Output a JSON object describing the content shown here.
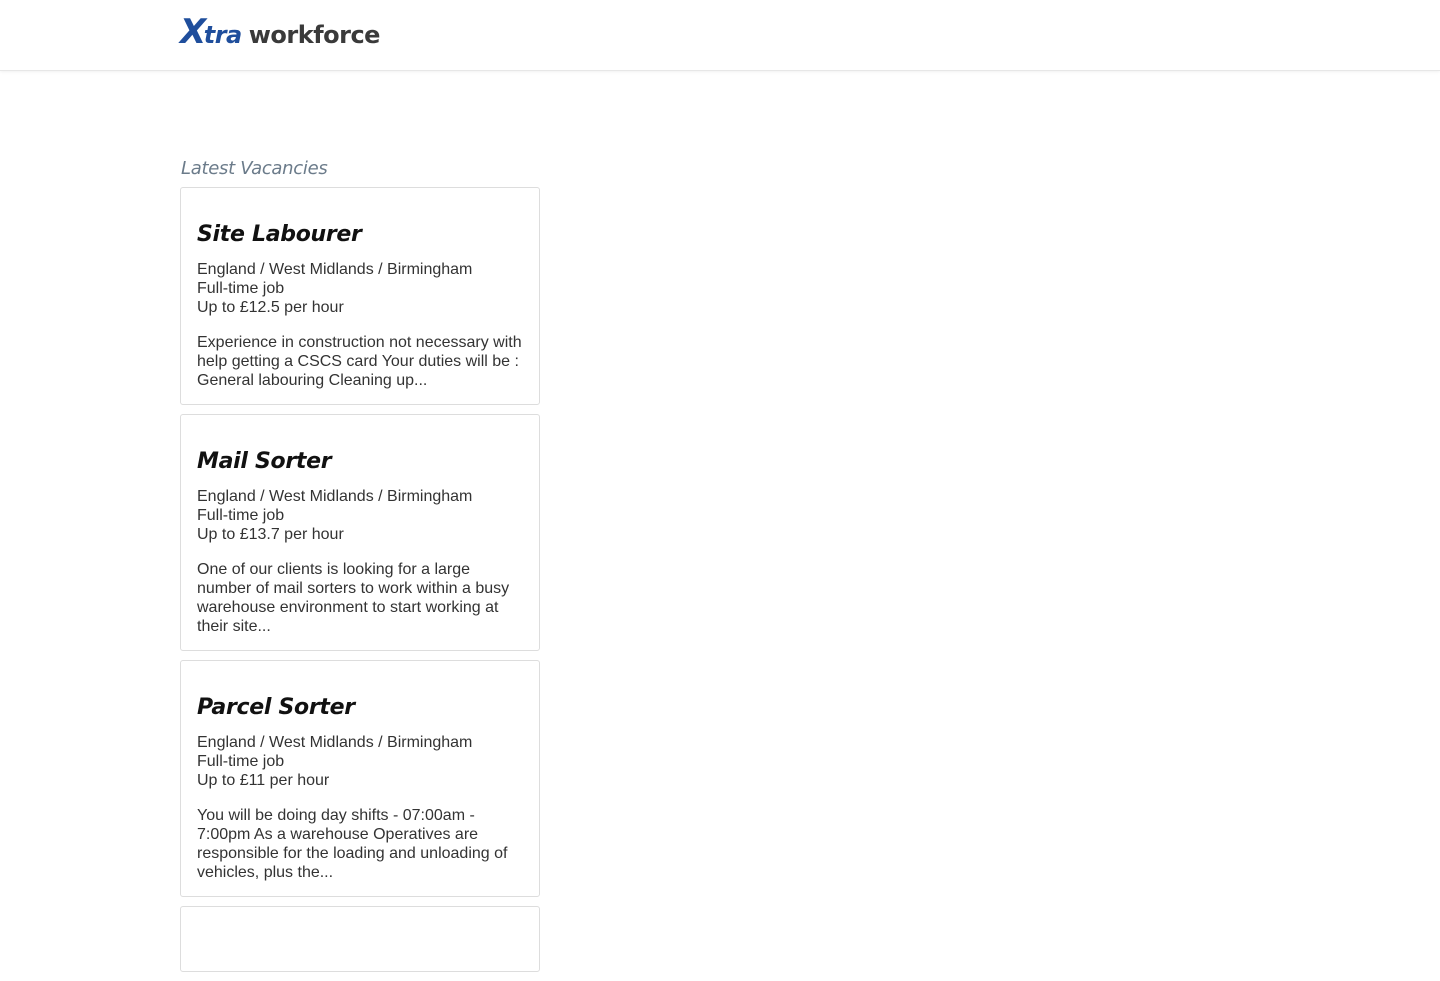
{
  "header": {
    "logo": {
      "x": "X",
      "tra": "tra",
      "workforce": "workforce"
    }
  },
  "main": {
    "section_title": "Latest Vacancies",
    "vacancies": [
      {
        "title": "Site Labourer",
        "location": "England / West Midlands / Birmingham",
        "job_type": "Full-time job",
        "pay": "Up to £12.5 per hour",
        "description": "Experience in construction not necessary with help getting a CSCS  card  Your duties will be : General labouring Cleaning up..."
      },
      {
        "title": "Mail Sorter",
        "location": "England / West Midlands / Birmingham",
        "job_type": "Full-time job",
        "pay": "Up to £13.7 per hour",
        "description": "One of our clients is looking for a  large number of mail sorters to work within a busy warehouse environment to start working at their site..."
      },
      {
        "title": "Parcel Sorter",
        "location": "England / West Midlands / Birmingham",
        "job_type": "Full-time job",
        "pay": "Up to £11 per hour",
        "description": "You will be doing day shifts - 07:00am - 7:00pm As a warehouse Operatives are responsible for the loading and unloading of vehicles, plus the..."
      },
      {
        "title": "",
        "location": "",
        "job_type": "",
        "pay": "",
        "description": ""
      }
    ]
  },
  "colors": {
    "brand_blue": "#1f4e9c",
    "brand_dark": "#3a3a3a",
    "section_title": "#6b7b8a",
    "card_border": "#dddddd"
  }
}
